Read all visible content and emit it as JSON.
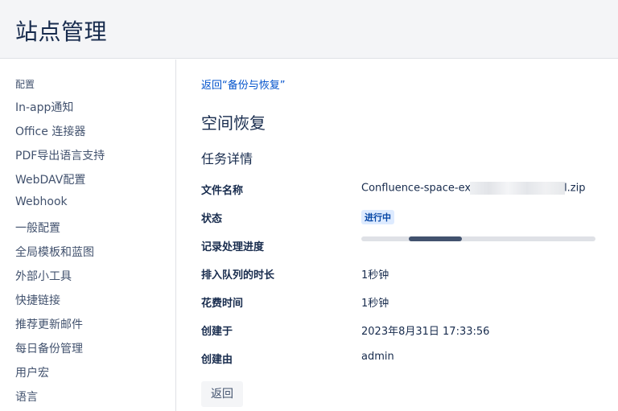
{
  "header": {
    "title": "站点管理"
  },
  "sidebar": {
    "section_label": "配置",
    "items": [
      {
        "label": "In-app通知"
      },
      {
        "label": "Office 连接器"
      },
      {
        "label": "PDF导出语言支持"
      },
      {
        "label": "WebDAV配置"
      },
      {
        "label": "Webhook"
      },
      {
        "label": "一般配置"
      },
      {
        "label": "全局模板和蓝图"
      },
      {
        "label": "外部小工具"
      },
      {
        "label": "快捷链接"
      },
      {
        "label": "推荐更新邮件"
      },
      {
        "label": "每日备份管理"
      },
      {
        "label": "用户宏"
      },
      {
        "label": "语言"
      }
    ]
  },
  "main": {
    "back_link": "返回“备份与恢复”",
    "title": "空间恢复",
    "subtitle": "任务详情",
    "details": {
      "file_name_label": "文件名称",
      "file_name_prefix": "Confluence-space-ex",
      "file_name_suffix": "l.zip",
      "status_label": "状态",
      "status_value": "进行中",
      "progress_label": "记录处理进度",
      "progress_fraction": 0.25,
      "queued_label": "排入队列的时长",
      "queued_value": "1秒钟",
      "elapsed_label": "花费时间",
      "elapsed_value": "1秒钟",
      "created_label": "创建于",
      "created_value": "2023年8月31日 17:33:56",
      "creator_label": "创建由",
      "creator_value": "admin"
    },
    "back_button": "返回"
  },
  "colors": {
    "link": "#0052cc",
    "badge_bg": "#deebff",
    "badge_text": "#0747a6",
    "progress_fill": "#42526e",
    "progress_track": "#dfe1e6"
  }
}
